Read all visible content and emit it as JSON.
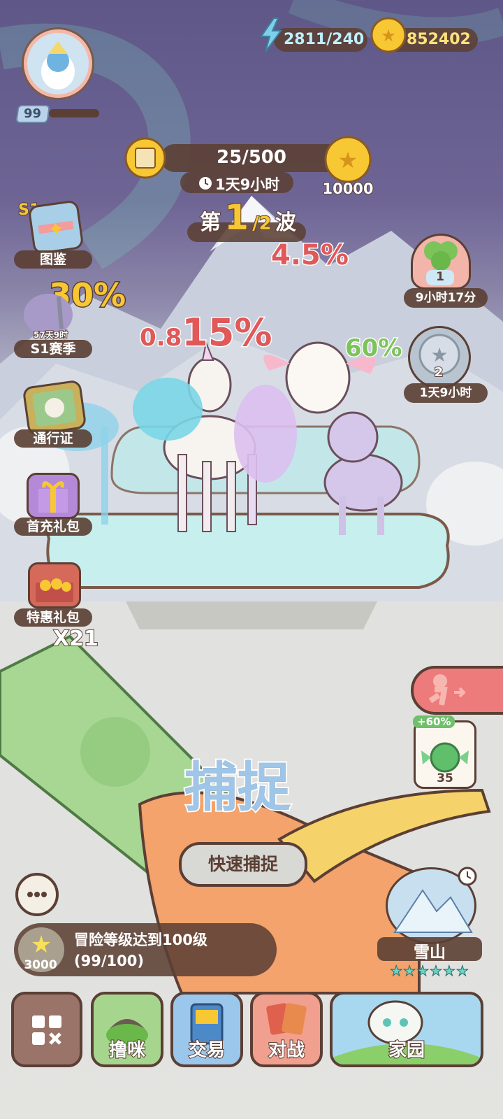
{
  "top_bar": {
    "energy": "2811/240",
    "coins": "852402",
    "player_level": "99"
  },
  "quest_banner": {
    "progress": "25/500",
    "timer": "1天9小时",
    "reward": "10000"
  },
  "wave": {
    "prefix": "第",
    "current": "1",
    "total": "/2",
    "suffix": "波"
  },
  "percentages": {
    "top": "4.5%",
    "unicorn_prefix": "0.8",
    "unicorn_main": "15%",
    "left_partial": "30%",
    "bird": "60%"
  },
  "left_menu": {
    "season_badge": "S1",
    "items": [
      {
        "label": "图鉴"
      },
      {
        "label": "S1赛季",
        "sub": "57天9时"
      },
      {
        "label": "通行证"
      },
      {
        "label": "首充礼包"
      },
      {
        "label": "特惠礼包"
      }
    ],
    "multiplier": "X21"
  },
  "right_menu": {
    "clover": {
      "count": "1",
      "label": "9小时17分"
    },
    "coin": {
      "count": "2",
      "label": "1天9小时"
    },
    "bait": {
      "bonus": "+60%",
      "count": "35"
    }
  },
  "capture": {
    "title": "捕捉",
    "quick_button": "快速捕捉"
  },
  "mission": {
    "reward": "3000",
    "text": "冒险等级达到100级",
    "progress": "(99/100)"
  },
  "location": {
    "name": "雪山",
    "stars": "★★★★★★"
  },
  "nav": {
    "items": [
      {
        "label": "撸咪"
      },
      {
        "label": "交易"
      },
      {
        "label": "对战"
      },
      {
        "label": "家园"
      }
    ]
  },
  "colors": {
    "accent_red": "#e05858",
    "accent_green": "#7cc45a",
    "accent_yellow": "#f7c734",
    "brown_dark": "#5b3f35"
  }
}
